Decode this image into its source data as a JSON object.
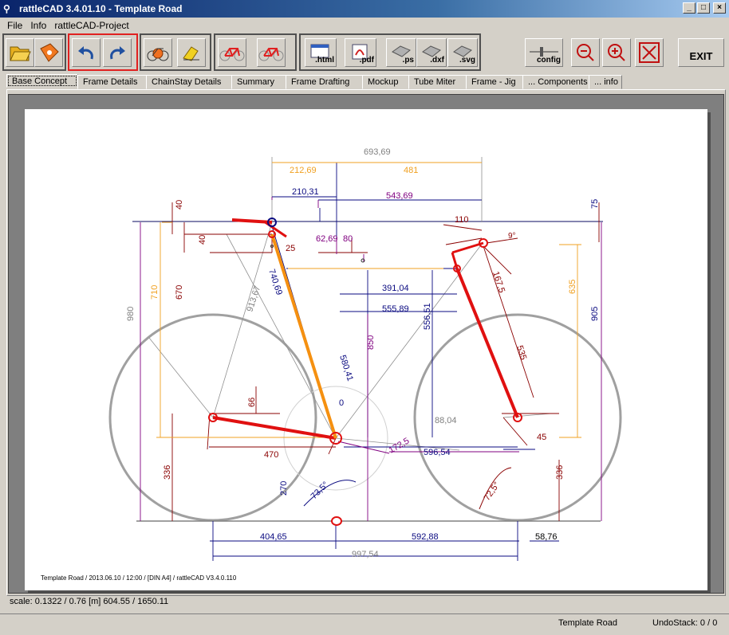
{
  "window": {
    "title": "rattleCAD  3.4.01.10 - Template Road"
  },
  "menu": [
    "File",
    "Info",
    "rattleCAD-Project"
  ],
  "toolbar": {
    "html_label": ".html",
    "pdf_label": ".pdf",
    "ps_label": ".ps",
    "dxf_label": ".dxf",
    "svg_label": ".svg",
    "config_label": "config",
    "exit_label": "EXIT"
  },
  "tabs": [
    "Base Concept",
    "Frame Details",
    "ChainStay Details",
    "Summary",
    "Frame Drafting",
    "Mockup",
    "Tube Miter",
    "Frame - Jig",
    "... Components",
    "... info"
  ],
  "drawing": {
    "dims": {
      "d693": "693,69",
      "d212": "212,69",
      "d481": "481",
      "d210": "210,31",
      "d543": "543,69",
      "d40a": "40",
      "d40b": "40",
      "d75": "75",
      "d110": "110",
      "d9": "9°",
      "d25": "25",
      "d62": "62,69",
      "d80": "80",
      "d391": "391,04",
      "d555": "555,89",
      "d556": "556,51",
      "d740": "740,69",
      "d913": "913,67",
      "d710": "710",
      "d670": "670",
      "d980": "980",
      "d635": "635",
      "d905": "905",
      "d850": "850",
      "d580": "580,41",
      "d0": "0",
      "d66": "66",
      "d470": "470",
      "d336a": "336",
      "d336b": "336",
      "d270": "270",
      "d735": "73,5°",
      "d725": "72,5°",
      "d1725": "172,5",
      "d596": "596,54",
      "d88": "88,04",
      "d45": "45",
      "d1675": "167,5",
      "d535": "535",
      "d404": "404,65",
      "d592": "592,88",
      "d58": "58,76",
      "d997": "997,54"
    },
    "footer": "Template Road   /   2013.06.10 / 12:00   /  [DIN A4]   /   rattleCAD    V3.4.0.110"
  },
  "status": {
    "scale": "scale: 0.1322 / 0.76  [m]  604.55 / 1650.11",
    "project": "Template Road",
    "undo": "UndoStack:  0 / 0"
  }
}
